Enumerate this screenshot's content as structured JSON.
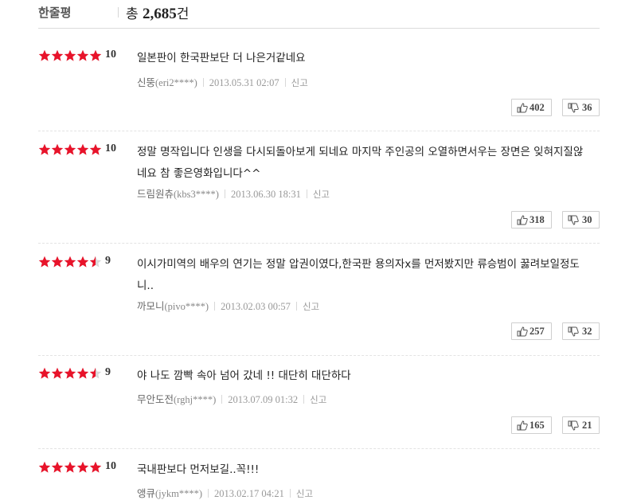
{
  "header": {
    "title": "한줄평",
    "count_prefix": "총",
    "count_value": "2,685",
    "count_suffix": "건"
  },
  "colors": {
    "star_full": "#e8132a",
    "star_empty": "#d8d8d8"
  },
  "reviews": [
    {
      "rating": 10,
      "score": "10",
      "text": "일본판이 한국판보단 더 나은거같네요",
      "nickname": "신뚱",
      "user_id": "(eri2****)",
      "date": "2013.05.31 02:07",
      "report": "신고",
      "likes": "402",
      "dislikes": "36"
    },
    {
      "rating": 10,
      "score": "10",
      "text": "정말 명작입니다 인생을 다시되돌아보게 되네요 마지막 주인공의 오열하면서우는 장면은 잊혀지질않네요 참 좋은영화입니다^^",
      "nickname": "드림원츄",
      "user_id": "(kbs3****)",
      "date": "2013.06.30 18:31",
      "report": "신고",
      "likes": "318",
      "dislikes": "30"
    },
    {
      "rating": 9,
      "score": "9",
      "text": "이시가미역의 배우의 연기는 정말 압권이였다,한국판 용의자x를 먼저봤지만 류승범이 꿇려보일정도니..",
      "nickname": "까모니",
      "user_id": "(pivo****)",
      "date": "2013.02.03 00:57",
      "report": "신고",
      "likes": "257",
      "dislikes": "32"
    },
    {
      "rating": 9,
      "score": "9",
      "text": "야 나도 깜빡 속아 넘어 갔네 !! 대단히 대단하다",
      "nickname": "무안도전",
      "user_id": "(rghj****)",
      "date": "2013.07.09 01:32",
      "report": "신고",
      "likes": "165",
      "dislikes": "21"
    },
    {
      "rating": 10,
      "score": "10",
      "text": "국내판보다 먼저보길..꼭!!!",
      "nickname": "앵큐",
      "user_id": "(jykm****)",
      "date": "2013.02.17 04:21",
      "report": "신고",
      "likes": "",
      "dislikes": ""
    }
  ]
}
